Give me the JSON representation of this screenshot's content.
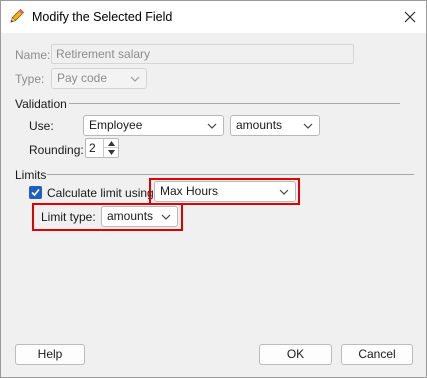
{
  "window": {
    "title": "Modify the Selected Field",
    "icon": "pencil-icon",
    "close_icon": "close-icon"
  },
  "name": {
    "label": "Name:",
    "value": "Retirement salary"
  },
  "type": {
    "label": "Type:",
    "value": "Pay code"
  },
  "validation": {
    "header": "Validation",
    "use_label": "Use:",
    "use_value": "Employee",
    "unit_value": "amounts",
    "rounding_label": "Rounding:",
    "rounding_value": "2"
  },
  "limits": {
    "header": "Limits",
    "calc_label": "Calculate limit using:",
    "calc_checked": true,
    "calc_value": "Max Hours",
    "limit_type_label": "Limit type:",
    "limit_type_value": "amounts"
  },
  "buttons": {
    "help": "Help",
    "ok": "OK",
    "cancel": "Cancel"
  },
  "colors": {
    "highlight": "#e00000",
    "checkbox": "#1f5fbf"
  }
}
